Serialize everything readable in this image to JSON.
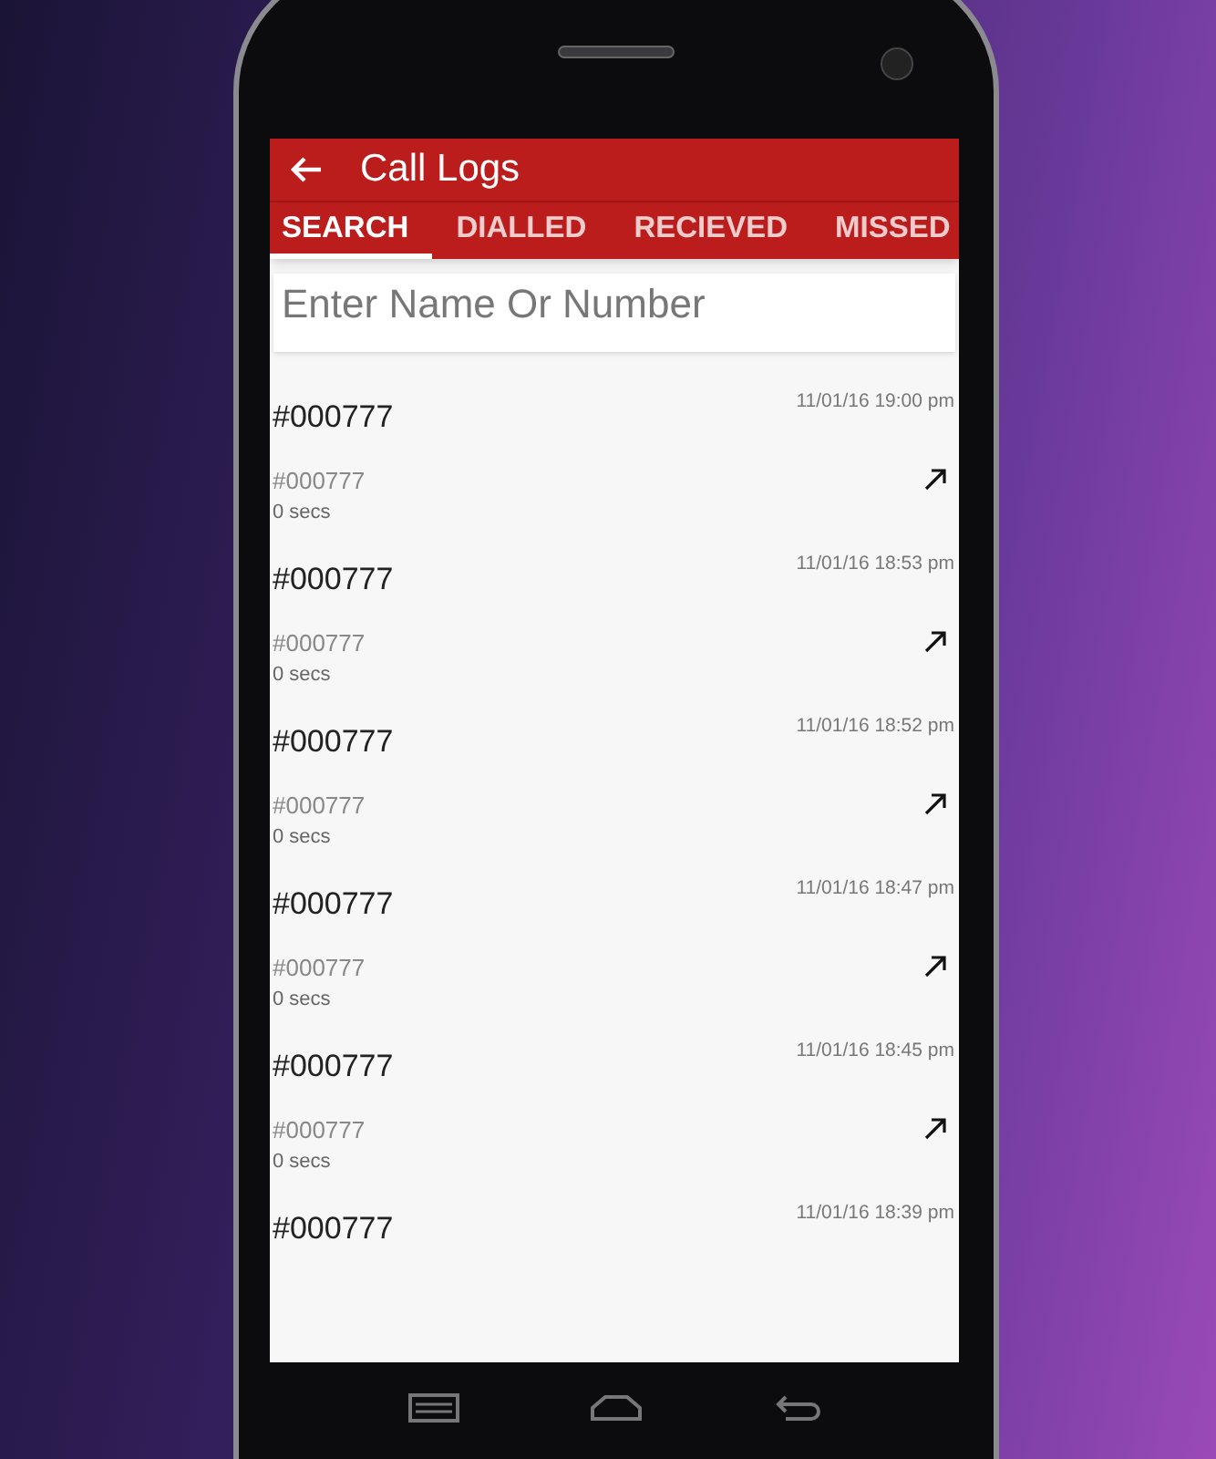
{
  "app_bar": {
    "title": "Call Logs"
  },
  "tabs": [
    {
      "label": "SEARCH",
      "selected": true
    },
    {
      "label": "DIALLED",
      "selected": false
    },
    {
      "label": "RECIEVED",
      "selected": false
    },
    {
      "label": "MISSED",
      "selected": false
    }
  ],
  "search": {
    "placeholder": "Enter Name Or Number"
  },
  "calls": [
    {
      "name": "#000777",
      "time": "11/01/16 19:00 pm",
      "number": "#000777",
      "duration": "0 secs",
      "kind": "outgoing"
    },
    {
      "name": "#000777",
      "time": "11/01/16 18:53 pm",
      "number": "#000777",
      "duration": "0 secs",
      "kind": "outgoing"
    },
    {
      "name": "#000777",
      "time": "11/01/16 18:52 pm",
      "number": "#000777",
      "duration": "0 secs",
      "kind": "outgoing"
    },
    {
      "name": "#000777",
      "time": "11/01/16 18:47 pm",
      "number": "#000777",
      "duration": "0 secs",
      "kind": "outgoing"
    },
    {
      "name": "#000777",
      "time": "11/01/16 18:45 pm",
      "number": "#000777",
      "duration": "0 secs",
      "kind": "outgoing"
    },
    {
      "name": "#000777",
      "time": "11/01/16 18:39 pm"
    }
  ]
}
